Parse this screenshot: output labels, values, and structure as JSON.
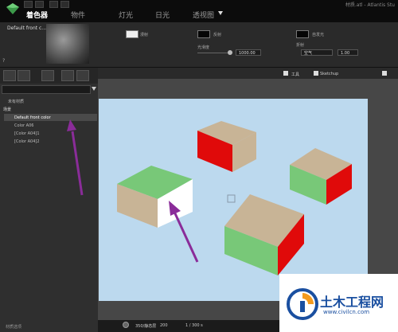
{
  "app": {
    "title": "材质.atl - Atlantis Stu"
  },
  "tabs": [
    {
      "label": "着色器",
      "active": true
    },
    {
      "label": "物件",
      "active": false
    },
    {
      "label": "灯光",
      "active": false
    },
    {
      "label": "日光",
      "active": false
    },
    {
      "label": "透视图",
      "active": false
    }
  ],
  "panel": {
    "material_name": "Default front c...",
    "diffuse_label": "漫射",
    "reflection_label": "反射",
    "glow_label": "自发光",
    "gloss_label": "光滑度",
    "gloss_value": "1000.00",
    "refraction_label": "折射",
    "refraction_select": "空气",
    "refraction_value": "1.00",
    "help": "?"
  },
  "tree": {
    "root": "未有材质",
    "group": "场景",
    "items": [
      "Default front color",
      "Color A06",
      "[Color A04]1",
      "[Color A04]2"
    ]
  },
  "left_footer": "材质选项",
  "viewport": {
    "bar_label": "Sketchup",
    "tool_label": "工具",
    "zoom": "200",
    "zoom_label": "350/静态层",
    "frames": "1 / 300 s"
  },
  "watermark": {
    "brand": "土木工程网",
    "url": "www.civilcn.com"
  },
  "colors": {
    "green": "#78c878",
    "red": "#e00a0a",
    "tan": "#c8b496",
    "sky": "#bcd9ee",
    "arrow": "#8a2c99"
  }
}
